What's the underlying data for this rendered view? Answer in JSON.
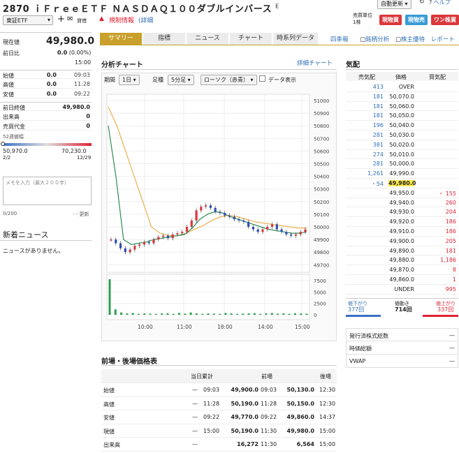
{
  "header": {
    "title": "2870 ｉＦｒｅｅＥＴＦ ＮＡＳＤＡＱ１００ダブルインバース",
    "title_suffix": "E",
    "market": "東証ETF",
    "watch_label": "貸借",
    "reg_label": "規制情報",
    "reg_detail": "(詳細",
    "auto_update": "自動更新",
    "help": "ヘルプ",
    "unit_label": "売買単位",
    "unit_value": "1株",
    "btn_spot_buy": "現物買",
    "btn_spot_sell": "現物売",
    "btn_one_click": "ワン株買"
  },
  "quote": {
    "price_label": "現在値",
    "price": "49,980.0",
    "change_label": "前日比",
    "change": "0.0",
    "change_pct": "(0.00%)",
    "change_time": "15:00",
    "rows": [
      {
        "label": "始値",
        "value": "0.0",
        "time": "09:03"
      },
      {
        "label": "高値",
        "value": "0.0",
        "time": "11:28"
      },
      {
        "label": "安値",
        "value": "0.0",
        "time": "09:22"
      }
    ],
    "prev_close_label": "前日終値",
    "prev_close": "49,980.0",
    "volume_label": "出来高",
    "volume": "0",
    "value_label": "売買代金",
    "value_amount": "0",
    "range_label": "52週値幅",
    "range_low": "50,970.0",
    "range_high": "70,230.0",
    "range_low_date": "2/2",
    "range_high_date": "12/29"
  },
  "memo": {
    "placeholder": "メモを入力（最大２００字）",
    "count": "0/200",
    "update": "- - 更新"
  },
  "news": {
    "title": "新着ニュース",
    "empty": "ニュースがありません。"
  },
  "tabs": [
    "サマリー",
    "指標",
    "ニュース",
    "チャート",
    "時系列データ"
  ],
  "links": {
    "quarterly": "四季報",
    "screener": "銘柄分析",
    "benefit": "株主優待",
    "report": "レポート"
  },
  "chart": {
    "title": "分析チャート",
    "detail": "詳細チャート",
    "period_label": "期間",
    "period": "1日",
    "interval_label": "足種",
    "interval": "5分足",
    "candle": "ローソク（赤青）",
    "data_label": "データ表示"
  },
  "orderbook": {
    "title": "気配",
    "col_ask": "売気配",
    "col_price": "価格",
    "col_bid": "買気配",
    "rows": [
      [
        "413",
        "OVER",
        ""
      ],
      [
        "181",
        "50,070.0",
        ""
      ],
      [
        "181",
        "50,060.0",
        ""
      ],
      [
        "181",
        "50,050.0",
        ""
      ],
      [
        "196",
        "50,040.0",
        ""
      ],
      [
        "281",
        "50,030.0",
        ""
      ],
      [
        "381",
        "50,020.0",
        ""
      ],
      [
        "274",
        "50,010.0",
        ""
      ],
      [
        "281",
        "50,000.0",
        ""
      ],
      [
        "1,261",
        "49,990.0",
        ""
      ],
      [
        "54",
        "49,980.0",
        ""
      ],
      [
        "",
        "49,950.0",
        "155"
      ],
      [
        "",
        "49,940.0",
        "260"
      ],
      [
        "",
        "49,930.0",
        "204"
      ],
      [
        "",
        "49,920.0",
        "186"
      ],
      [
        "",
        "49,910.0",
        "186"
      ],
      [
        "",
        "49,900.0",
        "205"
      ],
      [
        "",
        "49,890.0",
        "181"
      ],
      [
        "",
        "49,880.0",
        "1,186"
      ],
      [
        "",
        "49,870.0",
        "8"
      ],
      [
        "",
        "49,860.0",
        "1"
      ],
      [
        "",
        "UNDER",
        "995"
      ]
    ],
    "down_label": "値下がり",
    "down_count": "377回",
    "flat_label": "値動き",
    "flat_count": "714回",
    "up_label": "値上がり",
    "up_count": "337回"
  },
  "stats": [
    {
      "label": "発行済株式総数",
      "value": "—"
    },
    {
      "label": "時価総額",
      "value": "—"
    },
    {
      "label": "VWAP",
      "value": "—"
    }
  ],
  "price_table": {
    "title": "前場・後場価格表",
    "col_day": "当日累計",
    "col_am": "前場",
    "col_pm": "後場",
    "rows": [
      {
        "label": "始値",
        "day": "—",
        "day_t": "09:03",
        "am": "49,900.0",
        "am_t": "09:03",
        "pm": "50,130.0",
        "pm_t": "12:30"
      },
      {
        "label": "高値",
        "day": "—",
        "day_t": "11:28",
        "am": "50,190.0",
        "am_t": "11:28",
        "pm": "50,150.0",
        "pm_t": "12:30"
      },
      {
        "label": "安値",
        "day": "—",
        "day_t": "09:22",
        "am": "49,770.0",
        "am_t": "09:22",
        "pm": "49,860.0",
        "pm_t": "14:37"
      },
      {
        "label": "現値",
        "day": "—",
        "day_t": "15:00",
        "am": "50,190.0",
        "am_t": "11:30",
        "pm": "49,980.0",
        "pm_t": "15:00"
      },
      {
        "label": "出来高",
        "day": "—",
        "day_t": "",
        "am": "16,272",
        "am_t": "11:30",
        "pm": "6,564",
        "pm_t": "15:00"
      }
    ]
  },
  "chart_data": {
    "type": "line",
    "price_ticks": [
      51000,
      50900,
      50800,
      50700,
      50600,
      50500,
      50400,
      50300,
      50200,
      50100,
      50000,
      49900,
      49800,
      49700
    ],
    "volume_ticks": [
      7500,
      5000,
      2500,
      0
    ],
    "x_ticks": [
      "10:00",
      "11:00",
      "18:00",
      "14:00",
      "15:00"
    ],
    "candles": [
      49900,
      49870,
      49830,
      49800,
      49820,
      49850,
      49860,
      49880,
      49870,
      49900,
      49920,
      49930,
      49910,
      49940,
      49950,
      49960,
      50000,
      50050,
      50130,
      50160,
      50170,
      50150,
      50120,
      50110,
      50090,
      50080,
      50060,
      50050,
      50040,
      50000,
      49980,
      49960,
      49980,
      50000,
      50020,
      49980,
      49960,
      49940,
      49930,
      49940,
      49960,
      49980
    ],
    "ma_green": [
      50800,
      50400,
      49900,
      49860,
      49870,
      49880,
      49900,
      49910,
      49920,
      49930,
      49940,
      49990,
      50060,
      50100,
      50120,
      50110,
      50080,
      50060,
      50040,
      50020,
      50000,
      49980,
      49970,
      49960,
      49950,
      49950,
      49960
    ],
    "ma_orange": [
      50950,
      50800,
      50600,
      50400,
      50200,
      50000,
      49950,
      49930,
      49930,
      49950,
      49980,
      50010,
      50050,
      50080,
      50090,
      50080,
      50060,
      50040,
      50030,
      50020,
      50010,
      50000,
      49990,
      49990
    ],
    "volumes": [
      7800,
      1200,
      500,
      300,
      400,
      200,
      300,
      250,
      200,
      300,
      350,
      200,
      400,
      250,
      500,
      300,
      200,
      300,
      250,
      200,
      400,
      300,
      200,
      250,
      300,
      350,
      200,
      300,
      400,
      250,
      300,
      200,
      350,
      300,
      250
    ]
  }
}
